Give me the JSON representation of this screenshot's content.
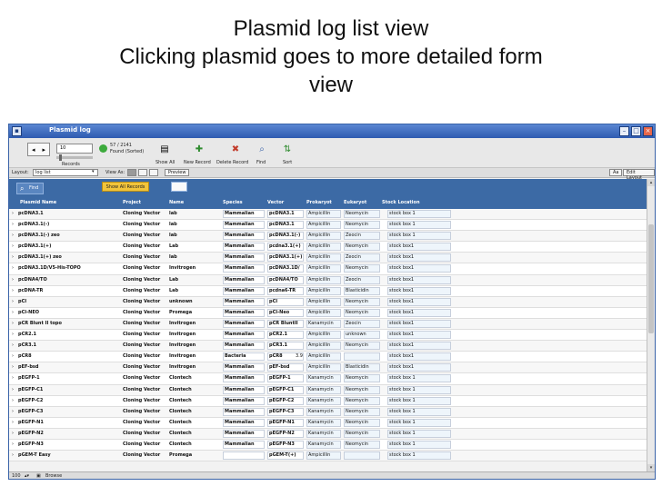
{
  "slide": {
    "title_lines": [
      "Plasmid log list view",
      "Clicking plasmid goes to more detailed form",
      "view"
    ]
  },
  "window": {
    "title": "Plasmid log"
  },
  "toolbar": {
    "record_number": "10",
    "records_label": "Records",
    "found_line1": "57 / 2141",
    "found_line2": "Found (Sorted)",
    "show_all": "Show All",
    "new_record": "New Record",
    "delete_record": "Delete Record",
    "find": "Find",
    "sort": "Sort"
  },
  "layoutbar": {
    "layout_label": "Layout:",
    "layout_value": "log list",
    "view_as_label": "View As:",
    "preview": "Preview",
    "aa": "Aa",
    "edit_layout": "Edit Layout"
  },
  "header": {
    "find_button": "Find",
    "show_all_records": "Show All Records",
    "columns": [
      "Plasmid Name",
      "Project",
      "Name",
      "Species",
      "Vector",
      "Prokaryot",
      "Eukaryot",
      "Stock Location"
    ]
  },
  "records": [
    [
      "pcDNA3.1",
      "Cloning Vector",
      "lab",
      "Mammalian",
      "pcDNA3.1",
      "Ampicillin",
      "Neomycin",
      "stock box 1"
    ],
    [
      "pcDNA3.1(-)",
      "Cloning Vector",
      "lab",
      "Mammalian",
      "pcDNA3.1",
      "Ampicillin",
      "Neomycin",
      "stock box 1"
    ],
    [
      "pcDNA3.1(-) zeo",
      "Cloning Vector",
      "lab",
      "Mammalian",
      "pcDNA3.1(-)",
      "Ampicillin",
      "Zeocin",
      "stock box 1"
    ],
    [
      "pcDNA3.1(+)",
      "Cloning Vector",
      "Lab",
      "Mammalian",
      "pcdna3.1(+)",
      "Ampicillin",
      "Neomycin",
      "stock box1"
    ],
    [
      "pcDNA3.1(+) zeo",
      "Cloning Vector",
      "lab",
      "Mammalian",
      "pcDNA3.1(+)",
      "Ampicillin",
      "Zeocin",
      "stock box1"
    ],
    [
      "pcDNA3.1D/V5-His-TOPO",
      "Cloning Vector",
      "Invitrogen",
      "Mammalian",
      "pcDNA3.1D/",
      "Ampicillin",
      "Neomycin",
      "stock box1"
    ],
    [
      "pcDNA4/TO",
      "Cloning Vector",
      "Lab",
      "Mammalian",
      "pcDNA4/TO",
      "Ampicillin",
      "Zeocin",
      "stock box1"
    ],
    [
      "pcDNA-TR",
      "Cloning Vector",
      "Lab",
      "Mammalian",
      "pcdna6-TR",
      "Ampicillin",
      "Blasticidin",
      "stock box1"
    ],
    [
      "pCI",
      "Cloning Vector",
      "unknown",
      "Mammalian",
      "pCI",
      "Ampicillin",
      "Neomycin",
      "stock box1"
    ],
    [
      "pCI-NEO",
      "Cloning Vector",
      "Promega",
      "Mammalian",
      "pCI-Neo",
      "Ampicillin",
      "Neomycin",
      "stock box1"
    ],
    [
      "pCR Blunt II topo",
      "Cloning Vector",
      "Invitrogen",
      "Mammalian",
      "pCR BluntII",
      "Kanamycin",
      "Zeocin",
      "stock box1"
    ],
    [
      "pCR2.1",
      "Cloning Vector",
      "Invitrogen",
      "Mammalian",
      "pCR2.1",
      "Ampicillin",
      "unknown",
      "stock box1"
    ],
    [
      "pCR3.1",
      "Cloning Vector",
      "Invitrogen",
      "Mammalian",
      "pCR3.1",
      "Ampicillin",
      "Neomycin",
      "stock box1"
    ],
    [
      "pCR8",
      "Cloning Vector",
      "Invitrogen",
      "Bacteria",
      "pCR8",
      "Ampicillin",
      "",
      "stock box1"
    ],
    [
      "pEF-bsd",
      "Cloning Vector",
      "Invitrogen",
      "Mammalian",
      "pEF-bsd",
      "Ampicillin",
      "Blasticidin",
      "stock box1"
    ],
    [
      "pEGFP-1",
      "Cloning Vector",
      "Clontech",
      "Mammalian",
      "pEGFP-1",
      "Kanamycin",
      "Neomycin",
      "stock box 1"
    ],
    [
      "pEGFP-C1",
      "Cloning Vector",
      "Clontech",
      "Mammalian",
      "pEGFP-C1",
      "Kanamycin",
      "Neomycin",
      "stock box 1"
    ],
    [
      "pEGFP-C2",
      "Cloning Vector",
      "Clontech",
      "Mammalian",
      "pEGFP-C2",
      "Kanamycin",
      "Neomycin",
      "stock box 1"
    ],
    [
      "pEGFP-C3",
      "Cloning Vector",
      "Clontech",
      "Mammalian",
      "pEGFP-C3",
      "Kanamycin",
      "Neomycin",
      "stock box 1"
    ],
    [
      "pEGFP-N1",
      "Cloning Vector",
      "Clontech",
      "Mammalian",
      "pEGFP-N1",
      "Kanamycin",
      "Neomycin",
      "stock box 1"
    ],
    [
      "pEGFP-N2",
      "Cloning Vector",
      "Clontech",
      "Mammalian",
      "pEGFP-N2",
      "Kanamycin",
      "Neomycin",
      "stock box 1"
    ],
    [
      "pEGFP-N3",
      "Cloning Vector",
      "Clontech",
      "Mammalian",
      "pEGFP-N3",
      "Kanamycin",
      "Neomycin",
      "stock box 1"
    ],
    [
      "pGEM-T Easy",
      "Cloning Vector",
      "Promega",
      "",
      "pGEM-T(+)",
      "Ampicillin",
      "",
      "stock box 1"
    ]
  ],
  "pcr8_extra": "3.9",
  "statusbar": {
    "zoom": "100",
    "mode": "Browse"
  }
}
